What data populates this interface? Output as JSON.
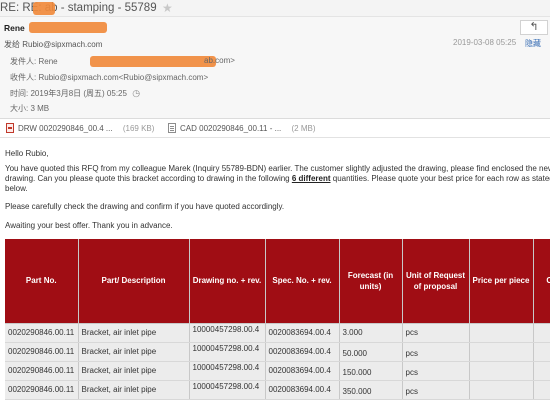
{
  "email": {
    "subject": "RE: RE: ab - stamping - 55789",
    "sender_name": "Rene",
    "to_line": "发给 Rubio@sipxmach.com",
    "reply_icon": "reply-arrow-icon",
    "datetime": "2019-03-08 05:25",
    "hide_details": "隐藏",
    "details": {
      "from_label": "发件人:",
      "from_value": "Rene",
      "from_suffix": "ab.com>",
      "to_label": "收件人:",
      "to_value": "Rubio@sipxmach.com<Rubio@sipxmach.com>",
      "time_label": "时间:",
      "time_value": "2019年3月8日 (周五) 05:25",
      "size_label": "大小:",
      "size_value": "3 MB"
    }
  },
  "attachments": [
    {
      "icon": "pdf-icon",
      "name": "DRW 0020290846_00.4 ...",
      "size": "(169 KB)"
    },
    {
      "icon": "doc-icon",
      "name": "CAD 0020290846_00.11 - ...",
      "size": "(2 MB)"
    }
  ],
  "body": {
    "greeting": "Hello Rubio,",
    "p1_line1": "You have quoted this RFQ from my colleague Marek (Inquiry 55789-BDN) earlier. The customer slightly adjusted the drawing, please find enclosed the new",
    "p1_line2_pre": "drawing. Can you please quote this bracket according to drawing in the following ",
    "p1_line2_link": "6 different",
    "p1_line2_post": " quantities. Please quote your best price for each row as stated",
    "p1_line3": "below.",
    "p2": "Please carefully check the drawing and confirm if you have quoted accordingly.",
    "p3": "Awaiting your best offer. Thank you in advance."
  },
  "table": {
    "headers": {
      "part_no": "Part No.",
      "description": "Part/ Description",
      "drawing": "Drawing no. + rev.",
      "spec": "Spec. No. + rev.",
      "forecast": "Forecast (in units)",
      "unit": "Unit of Request of proposal",
      "price": "Price per piece",
      "extra": "C"
    },
    "rows": [
      {
        "part_no": "0020290846.00.11",
        "description": "Bracket, air inlet pipe",
        "drawing": "10000457298.00.4",
        "spec": "0020083694.00.4",
        "forecast": "3.000",
        "unit": "pcs",
        "price": "",
        "extra": ""
      },
      {
        "part_no": "0020290846.00.11",
        "description": "Bracket, air inlet pipe",
        "drawing": "10000457298.00.4",
        "spec": "0020083694.00.4",
        "forecast": "50.000",
        "unit": "pcs",
        "price": "",
        "extra": ""
      },
      {
        "part_no": "0020290846.00.11",
        "description": "Bracket, air inlet pipe",
        "drawing": "10000457298.00.4",
        "spec": "0020083694.00.4",
        "forecast": "150.000",
        "unit": "pcs",
        "price": "",
        "extra": ""
      },
      {
        "part_no": "0020290846.00.11",
        "description": "Bracket, air inlet pipe",
        "drawing": "10000457298.00.4",
        "spec": "0020083694.00.4",
        "forecast": "350.000",
        "unit": "pcs",
        "price": "",
        "extra": ""
      }
    ]
  },
  "colors": {
    "table_header_bg": "#a00d14",
    "redaction": "#f08a3c",
    "link": "#3a6fb5"
  }
}
